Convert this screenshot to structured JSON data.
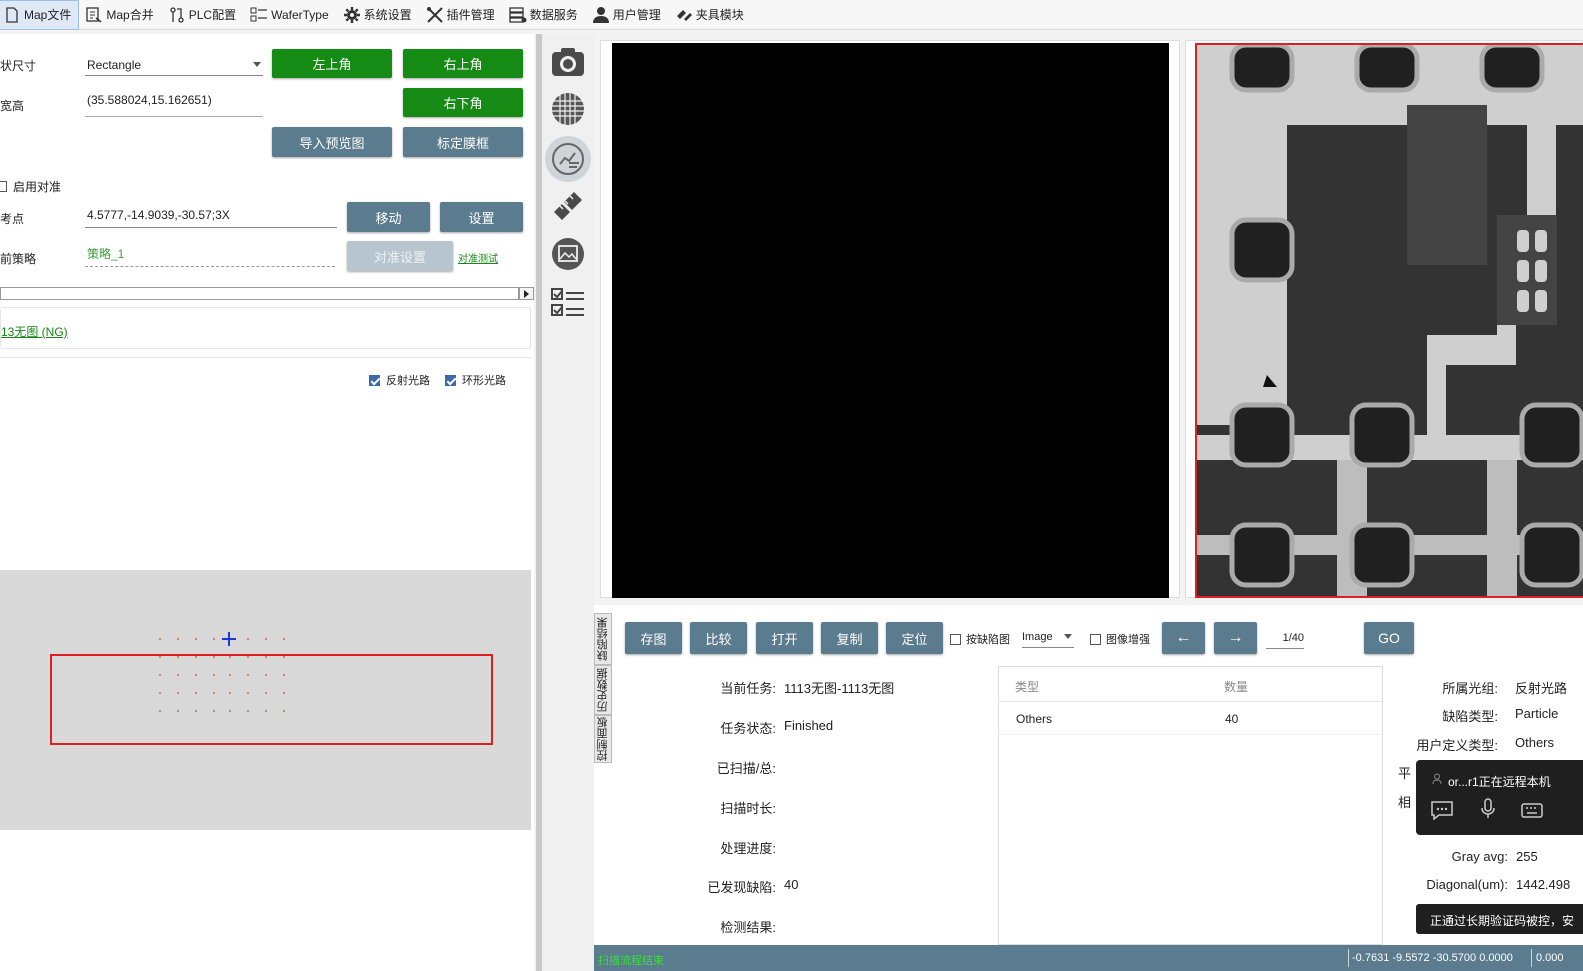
{
  "menu": [
    {
      "label": "Map文件",
      "icon": "document-icon",
      "active": true
    },
    {
      "label": "Map合并",
      "icon": "merge-icon",
      "active": false
    },
    {
      "label": "PLC配置",
      "icon": "plc-icon",
      "active": false
    },
    {
      "label": "WaferType",
      "icon": "list-icon",
      "active": false
    },
    {
      "label": "系统设置",
      "icon": "gear-icon",
      "active": false
    },
    {
      "label": "插件管理",
      "icon": "tools-icon",
      "active": false
    },
    {
      "label": "数据服务",
      "icon": "database-icon",
      "active": false
    },
    {
      "label": "用户管理",
      "icon": "user-icon",
      "active": false
    },
    {
      "label": "夹具模块",
      "icon": "fixture-icon",
      "active": false
    }
  ],
  "left": {
    "shape_label": "状尺寸",
    "shape_value": "Rectangle",
    "wh_label": "宽高",
    "wh_value": "(35.588024,15.162651)",
    "btn_top_left": "左上角",
    "btn_top_right": "右上角",
    "btn_bottom_right": "右下角",
    "btn_import_preview": "导入预览图",
    "btn_calibrate": "标定膜框",
    "enable_align": "启用对准",
    "ref_label": "考点",
    "ref_value": "4.5777,-14.9039,-30.57;3X",
    "btn_move": "移动",
    "btn_set": "设置",
    "strategy_label": "前策略",
    "strategy_value": "策略_1",
    "btn_align_settings": "对准设置",
    "align_test_link": "对准测试",
    "result_link": "13无图 (NG)",
    "chk_reflect": "反射光路",
    "chk_ring": "环形光路"
  },
  "toolbar": {
    "save_image": "存图",
    "compare": "比较",
    "open": "打开",
    "copy": "复制",
    "locate": "定位",
    "by_defect": "按缺陷图",
    "image_select": "Image",
    "enhance": "图像增强",
    "prev": "←",
    "next": "→",
    "page": "1/40",
    "go": "GO"
  },
  "vtabs": [
    "缺陷结果",
    "历史数据",
    "控制面板"
  ],
  "info": {
    "task_label": "当前任务:",
    "task_value": "1113无图-1113无图",
    "status_label": "任务状态:",
    "status_value": "Finished",
    "scanned_label": "已扫描/总:",
    "scanned_value": "",
    "duration_label": "扫描时长:",
    "duration_value": "",
    "progress_label": "处理进度:",
    "progress_value": "",
    "defects_label": "已发现缺陷:",
    "defects_value": "40",
    "result_label": "检测结果:",
    "result_value": ""
  },
  "defect_table": {
    "headers": [
      "类型",
      "数量"
    ],
    "rows": [
      [
        "Others",
        "40"
      ]
    ]
  },
  "details": {
    "group_label": "所属光组:",
    "group_value": "反射光路",
    "type_label": "缺陷类型:",
    "type_value": "Particle",
    "user_type_label": "用户定义类型:",
    "user_type_value": "Others",
    "avg_label": "平",
    "rel_label": "相",
    "gray_label": "Gray avg:",
    "gray_value": "255",
    "diag_label": "Diagonal(um):",
    "diag_value": "1442.498"
  },
  "remote_popup": {
    "text": "or...r1正在远程本机"
  },
  "toast": {
    "text": "正通过长期验证码被控，安"
  },
  "status": {
    "left_text": "扫描流程结束",
    "right_text": "-0.7631 -9.5572 -30.5700 0.0000",
    "right_extra": "0.000"
  },
  "colors": {
    "green": "#158a15",
    "slate": "#5b7c8e",
    "red": "#e02020"
  }
}
